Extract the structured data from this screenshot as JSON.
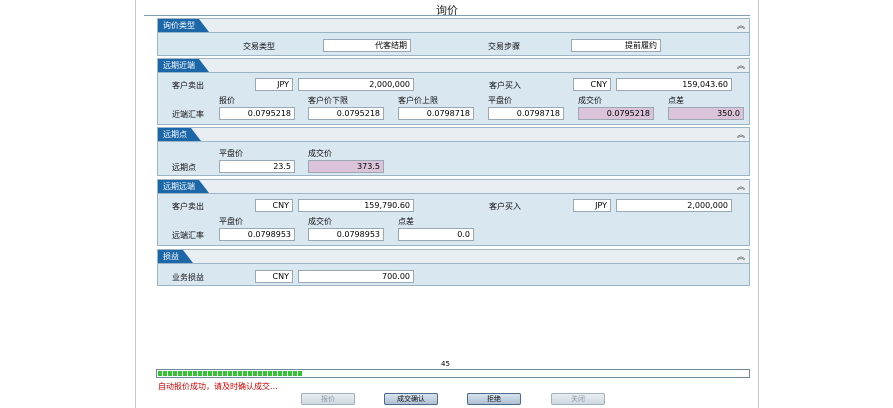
{
  "window": {
    "title": "询价"
  },
  "sections": {
    "inquiry_type": {
      "header": "询价类型",
      "trade_type_label": "交易类型",
      "trade_type_value": "代客结期",
      "trade_step_label": "交易步骤",
      "trade_step_value": "提前履约"
    },
    "far_near": {
      "header": "远期近端",
      "client_sell_label": "客户卖出",
      "client_sell_ccy": "JPY",
      "client_sell_amount": "2,000,000",
      "client_buy_label": "客户买入",
      "client_buy_ccy": "CNY",
      "client_buy_amount": "159,043.60",
      "col_quote": "报价",
      "col_lower": "客户价下限",
      "col_upper": "客户价上限",
      "col_flat": "平盘价",
      "col_deal": "成交价",
      "col_points": "点差",
      "row_label": "近端汇率",
      "quote": "0.0795218",
      "lower": "0.0795218",
      "upper": "0.0798718",
      "flat": "0.0798718",
      "deal": "0.0795218",
      "points": "350.0"
    },
    "far_points": {
      "header": "远期点",
      "col_flat": "平盘价",
      "col_deal": "成交价",
      "row_label": "远期点",
      "flat": "23.5",
      "deal": "373.5"
    },
    "far_far": {
      "header": "远期远端",
      "client_sell_label": "客户卖出",
      "client_sell_ccy": "CNY",
      "client_sell_amount": "159,790.60",
      "client_buy_label": "客户买入",
      "client_buy_ccy": "JPY",
      "client_buy_amount": "2,000,000",
      "col_flat": "平盘价",
      "col_deal": "成交价",
      "col_points": "点差",
      "row_label": "远端汇率",
      "flat": "0.0798953",
      "deal": "0.0798953",
      "points": "0.0"
    },
    "pnl": {
      "header": "损益",
      "label": "业务损益",
      "ccy": "CNY",
      "amount": "700.00"
    }
  },
  "progress": {
    "countdown": "45",
    "fraction": 0.25,
    "color": "#36c236"
  },
  "status": {
    "message": "自动报价成功，请及时确认成交...",
    "color": "#d00000"
  },
  "buttons": {
    "quote": "报价",
    "confirm": "成交确认",
    "reject": "拒绝",
    "close": "关闭"
  },
  "icons": {
    "collapse": "double-chevron-up-icon"
  }
}
